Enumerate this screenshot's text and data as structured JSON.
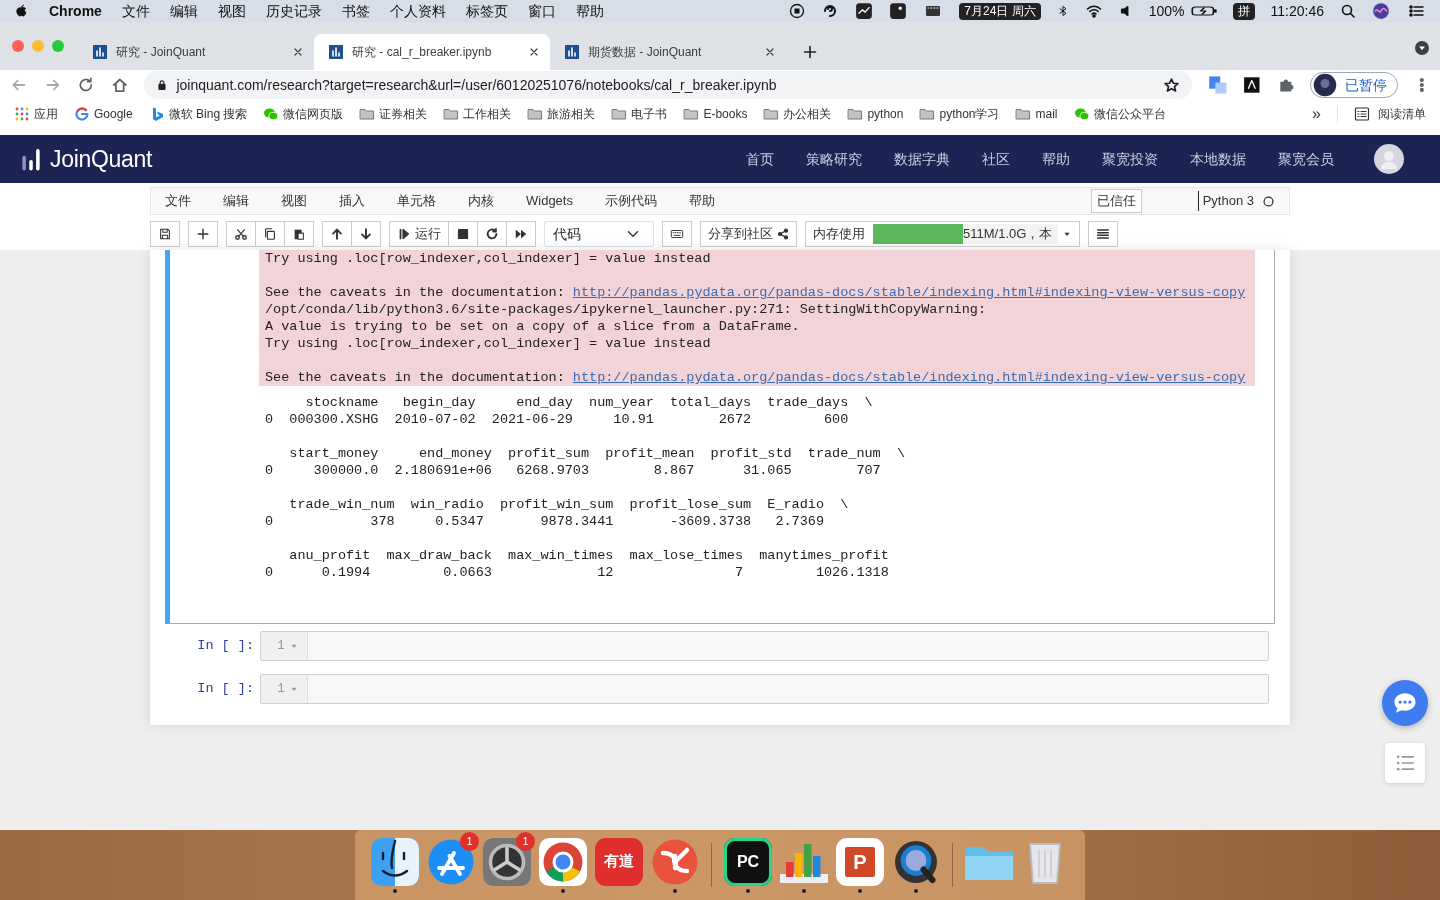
{
  "menubar": {
    "app": "Chrome",
    "menus": [
      "文件",
      "编辑",
      "视图",
      "历史记录",
      "书签",
      "个人资料",
      "标签页",
      "窗口",
      "帮助"
    ],
    "date": "7月24日 周六",
    "battery": "100%",
    "input_method": "拼",
    "time": "11:20:46"
  },
  "tabs": [
    {
      "title": "研究 - JoinQuant",
      "selected": false
    },
    {
      "title": "研究 - cal_r_breaker.ipynb",
      "selected": true
    },
    {
      "title": "期货数据 - JoinQuant",
      "selected": false
    }
  ],
  "address_bar": {
    "url": "joinquant.com/research?target=research&url=/user/60120251076/notebooks/cal_r_breaker.ipynb",
    "profile": "已暂停"
  },
  "bookmarks": [
    {
      "kind": "apps",
      "label": "应用"
    },
    {
      "kind": "google",
      "label": "Google"
    },
    {
      "kind": "bing",
      "label": "微软 Bing 搜索"
    },
    {
      "kind": "wechat",
      "label": "微信网页版"
    },
    {
      "kind": "folder",
      "label": "证券相关"
    },
    {
      "kind": "folder",
      "label": "工作相关"
    },
    {
      "kind": "folder",
      "label": "旅游相关"
    },
    {
      "kind": "folder",
      "label": "电子书"
    },
    {
      "kind": "folder",
      "label": "E-books"
    },
    {
      "kind": "folder",
      "label": "办公相关"
    },
    {
      "kind": "folder",
      "label": "python"
    },
    {
      "kind": "folder",
      "label": "python学习"
    },
    {
      "kind": "folder",
      "label": "mail"
    },
    {
      "kind": "wechat",
      "label": "微信公众平台"
    }
  ],
  "bookmarks_more": "»",
  "reading_list": "阅读清单",
  "site_nav": {
    "logo": "JoinQuant",
    "items": [
      "首页",
      "策略研究",
      "数据字典",
      "社区",
      "帮助",
      "聚宽投资",
      "本地数据",
      "聚宽会员"
    ]
  },
  "notebook_menu": {
    "items": [
      "文件",
      "编辑",
      "视图",
      "插入",
      "单元格",
      "内核",
      "Widgets",
      "示例代码",
      "帮助"
    ],
    "trusted": "已信任",
    "kernel": "Python 3"
  },
  "toolbar": {
    "run": "运行",
    "cell_type": "代码",
    "share": "分享到社区",
    "memory": {
      "label": "内存使用",
      "level": 0.5,
      "reading": "511M/1.0G，本"
    }
  },
  "output": {
    "stderr": [
      {
        "kind": "text",
        "text": "Try using .loc[row_indexer,col_indexer] = value instead"
      },
      {
        "kind": "link",
        "text": "See the caveats in the documentation: ",
        "link": "http://pandas.pydata.org/pandas-docs/stable/indexing.html#indexing-view-versus-copy"
      },
      {
        "kind": "text",
        "text": "/opt/conda/lib/python3.6/site-packages/ipykernel_launcher.py:271: SettingWithCopyWarning:\nA value is trying to be set on a copy of a slice from a DataFrame.\nTry using .loc[row_indexer,col_indexer] = value instead"
      },
      {
        "kind": "link",
        "text": "See the caveats in the documentation: ",
        "link": "http://pandas.pydata.org/pandas-docs/stable/indexing.html#indexing-view-versus-copy"
      }
    ],
    "dataframe": [
      {
        "header": "     stockname   begin_day     end_day  num_year  total_days  trade_days  \\",
        "row": "0  000300.XSHG  2010-07-02  2021-06-29     10.91        2672         600"
      },
      {
        "header": "   start_money     end_money  profit_sum  profit_mean  profit_std  trade_num  \\",
        "row": "0     300000.0  2.180691e+06   6268.9703        8.867      31.065        707"
      },
      {
        "header": "   trade_win_num  win_radio  profit_win_sum  profit_lose_sum  E_radio  \\",
        "row": "0            378     0.5347       9878.3441       -3609.3738   2.7369"
      },
      {
        "header": "   anu_profit  max_draw_back  max_win_times  max_lose_times  manytimes_profit",
        "row": "0      0.1994         0.0663             12               7         1026.1318"
      }
    ]
  },
  "empty_cells": [
    {
      "prompt": "In [ ]:",
      "line": "1"
    },
    {
      "prompt": "In [ ]:",
      "line": "1"
    }
  ],
  "dock": [
    {
      "kind": "finder",
      "running": true
    },
    {
      "kind": "appstore",
      "badge": "1",
      "running": false
    },
    {
      "kind": "settings",
      "badge": "1",
      "running": false
    },
    {
      "kind": "chrome",
      "running": true
    },
    {
      "kind": "youdao",
      "label": "有道",
      "running": false
    },
    {
      "kind": "swirl",
      "running": true
    },
    {
      "kind": "separator"
    },
    {
      "kind": "pycharm",
      "label": "PC",
      "running": true
    },
    {
      "kind": "charts",
      "running": true
    },
    {
      "kind": "powerpoint",
      "label": "P",
      "running": true
    },
    {
      "kind": "quicktime",
      "running": true
    },
    {
      "kind": "separator"
    },
    {
      "kind": "folder",
      "running": false
    },
    {
      "kind": "trash",
      "running": false
    }
  ]
}
